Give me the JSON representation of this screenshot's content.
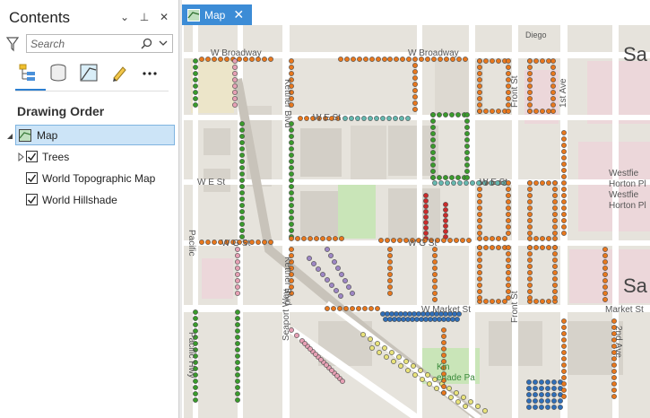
{
  "contents": {
    "title": "Contents",
    "search": {
      "placeholder": "Search"
    },
    "section_title": "Drawing Order",
    "layers": [
      {
        "label": "Map"
      },
      {
        "label": "Trees"
      },
      {
        "label": "World Topographic Map"
      },
      {
        "label": "World Hillshade"
      }
    ]
  },
  "map_tab": {
    "label": "Map"
  },
  "map_labels": {
    "w_broadway_1": "W Broadway",
    "w_broadway_2": "W Broadway",
    "w_e_st": "W E St",
    "w_e_st_2": "W E St",
    "w_e_st_3": "W E St",
    "w_g_st": "W G St",
    "w_g_st_2": "W G St",
    "w_market_st": "W Market St",
    "market_st": "Market St",
    "kettner_blvd_1": "Kettner Blvd",
    "kettner_blvd_2": "Kettner Blvd",
    "front_st_1": "Front St",
    "front_st_2": "Front St",
    "first_ave": "1st Ave",
    "second_ave": "2nd Ave",
    "pacific_hwy_1": "Pacific",
    "pacific_hwy_2": "Pacific Hwy",
    "seaport_way": "Seaport Way",
    "diego": "Diego",
    "city_big": "Sa",
    "city_big_2": "Sa",
    "westfield_1": "Westfie",
    "westfield_2": "Horton Pl",
    "westfield_3": "Westfie",
    "westfield_4": "Horton Pl",
    "kin": "Kin",
    "promenade": "enade Pa"
  },
  "colors": {
    "accent": "#3c8cd6",
    "selection_fill": "#cce4f7",
    "tree_orange": "#e8781e",
    "tree_green": "#3a9b2c",
    "tree_pink": "#e6a0b4",
    "tree_yellow": "#e8e27a",
    "tree_blue": "#2f6eb8",
    "tree_teal": "#66b9b0",
    "tree_red": "#cc2b2b",
    "tree_purple": "#9d86c4"
  },
  "icons": {
    "pin": "pin-icon",
    "auto_hide": "auto-hide-icon",
    "filter": "filter-icon",
    "search": "search-icon"
  }
}
